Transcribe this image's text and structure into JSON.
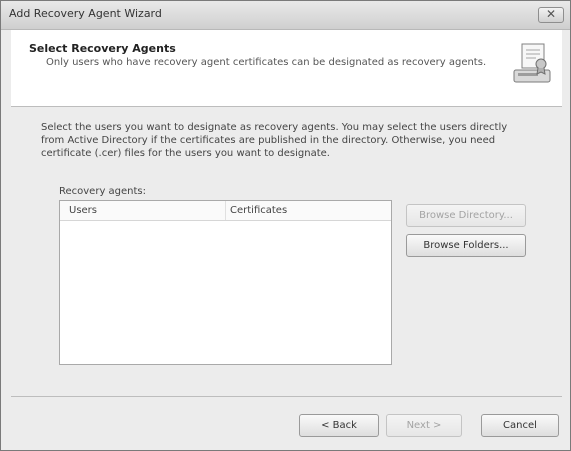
{
  "window": {
    "title": "Add Recovery Agent Wizard",
    "close_glyph": "✕"
  },
  "header": {
    "title": "Select Recovery Agents",
    "subtitle": "Only users who have recovery agent certificates can be designated as recovery agents.",
    "icon": "wizard-certificate-icon"
  },
  "main": {
    "instructions": "Select the users you want to designate as recovery agents. You may select the users directly from Active Directory if the certificates are published in the directory. Otherwise, you need certificate (.cer) files for the users you want to designate.",
    "list_label": "Recovery agents:",
    "columns": [
      "Users",
      "Certificates"
    ],
    "rows": []
  },
  "side_buttons": {
    "browse_directory": "Browse Directory...",
    "browse_folders": "Browse Folders..."
  },
  "footer": {
    "back": "< Back",
    "next": "Next >",
    "cancel": "Cancel"
  }
}
